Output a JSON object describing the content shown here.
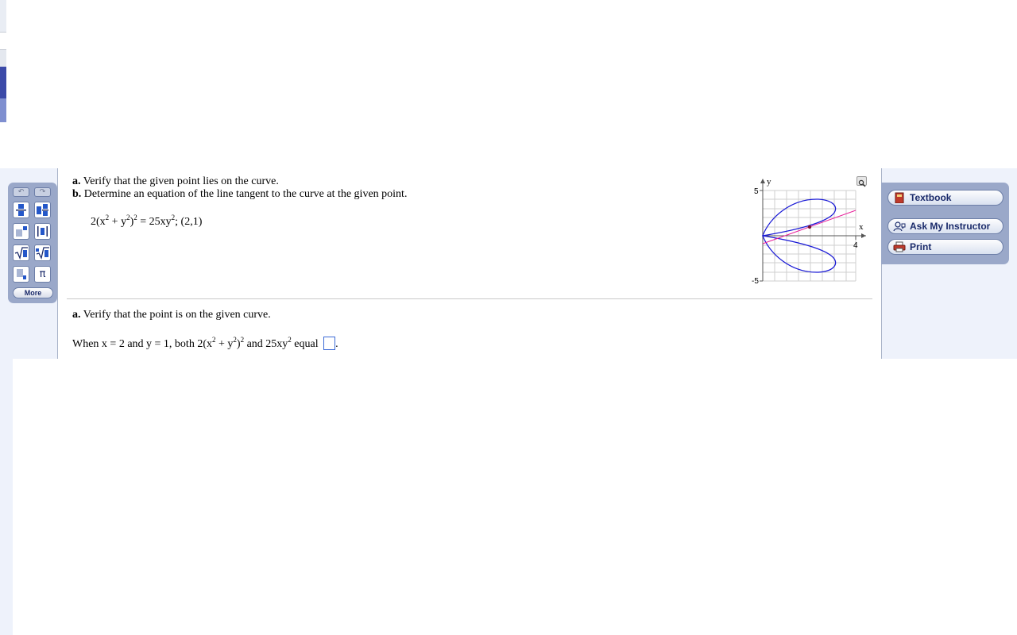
{
  "toolbar": {
    "undo_label": "↶",
    "redo_label": "↷",
    "more_label": "More",
    "pi_label": "π"
  },
  "problem": {
    "part_a_label": "a.",
    "part_a_text": " Verify that the given point lies on the curve.",
    "part_b_label": "b.",
    "part_b_text": " Determine an equation of the line tangent to the curve at the given point.",
    "eq": {
      "p1": "2(x",
      "s1": "2",
      "p2": " + y",
      "s2": "2",
      "p3": ")",
      "s3": "2",
      "p4": " = 25xy",
      "s4": "2",
      "p5": "; (2,1)"
    }
  },
  "graph": {
    "y_label": "y",
    "x_label": "x",
    "y_max_label": "5",
    "y_min_label": "-5",
    "x_max_label": "4",
    "zoom_icon": "magnifier-icon",
    "curve_color": "#1a1ad6",
    "tangent_color": "#e8209a"
  },
  "answer": {
    "heading_label": "a.",
    "heading_text": " Verify that the point is on the given curve.",
    "s_p1": "When x = 2 and y = 1, both 2(x",
    "s_s1": "2",
    "s_p2": " + y",
    "s_s2": "2",
    "s_p3": ")",
    "s_s3": "2",
    "s_p4": " and 25xy",
    "s_s4": "2",
    "s_p5": " equal ",
    "s_p6": "."
  },
  "sidebar": {
    "textbook": "Textbook",
    "ask": "Ask My Instructor",
    "print": "Print",
    "textbook_icon": "book-icon",
    "ask_icon": "person-icon",
    "print_icon": "printer-icon"
  }
}
